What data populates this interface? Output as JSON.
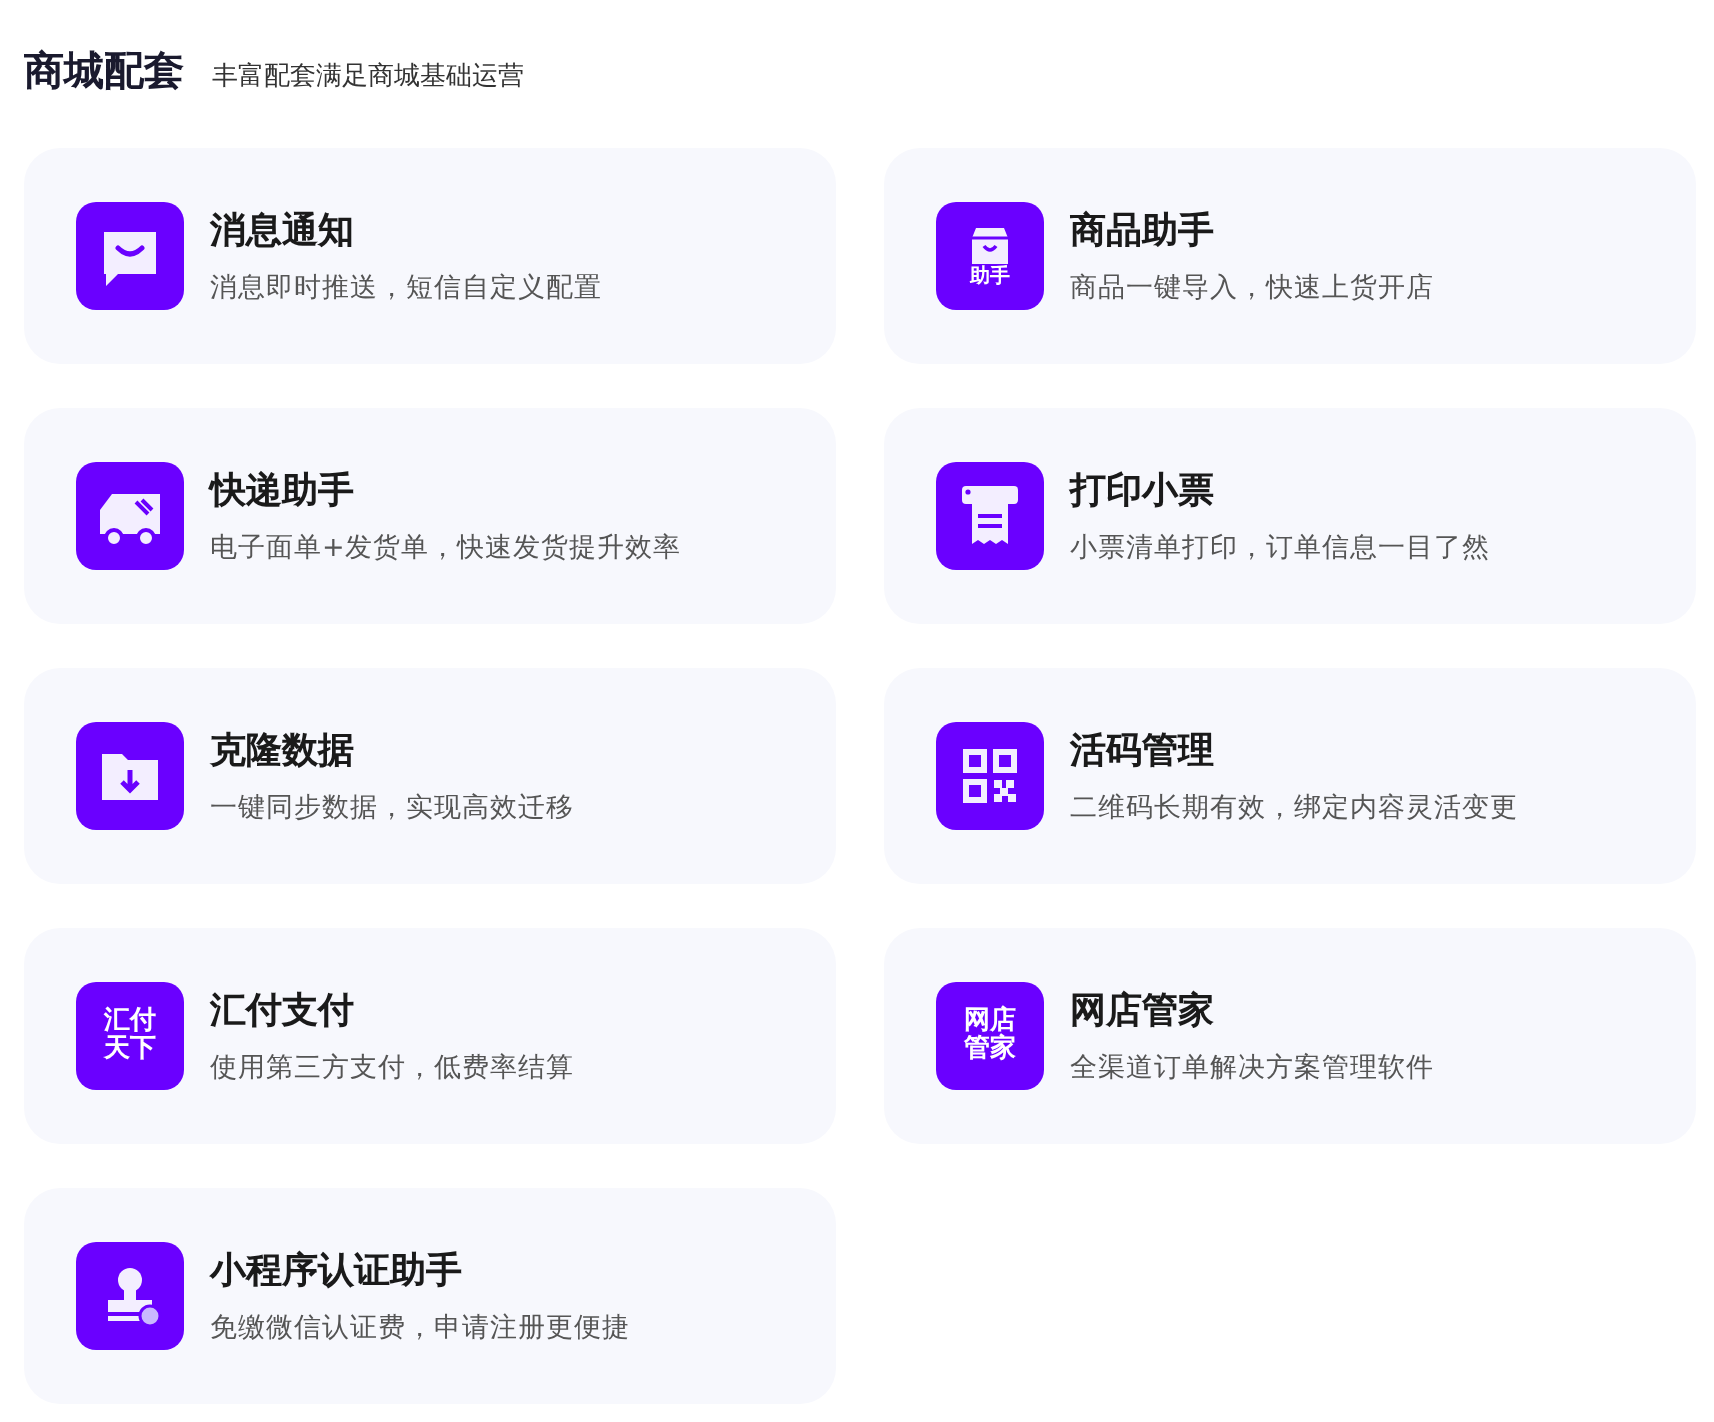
{
  "header": {
    "title": "商城配套",
    "subtitle": "丰富配套满足商城基础运营"
  },
  "cards": [
    {
      "kind": "chat",
      "title": "消息通知",
      "desc": "消息即时推送，短信自定义配置"
    },
    {
      "kind": "bag",
      "icon_text": [
        "助手"
      ],
      "title": "商品助手",
      "desc": "商品一键导入，快速上货开店"
    },
    {
      "kind": "truck",
      "title": "快递助手",
      "desc": "电子面单+发货单，快速发货提升效率"
    },
    {
      "kind": "printer",
      "title": "打印小票",
      "desc": "小票清单打印，订单信息一目了然"
    },
    {
      "kind": "folder",
      "title": "克隆数据",
      "desc": "一键同步数据，实现高效迁移"
    },
    {
      "kind": "qr",
      "title": "活码管理",
      "desc": "二维码长期有效，绑定内容灵活变更"
    },
    {
      "kind": "logo",
      "icon_text": [
        "汇付",
        "天下"
      ],
      "title": "汇付支付",
      "desc": "使用第三方支付，低费率结算"
    },
    {
      "kind": "logo",
      "icon_text": [
        "网店",
        "管家"
      ],
      "title": "网店管家",
      "desc": "全渠道订单解决方案管理软件"
    },
    {
      "kind": "stamp",
      "title": "小程序认证助手",
      "desc": "免缴微信认证费，申请注册更便捷"
    }
  ]
}
